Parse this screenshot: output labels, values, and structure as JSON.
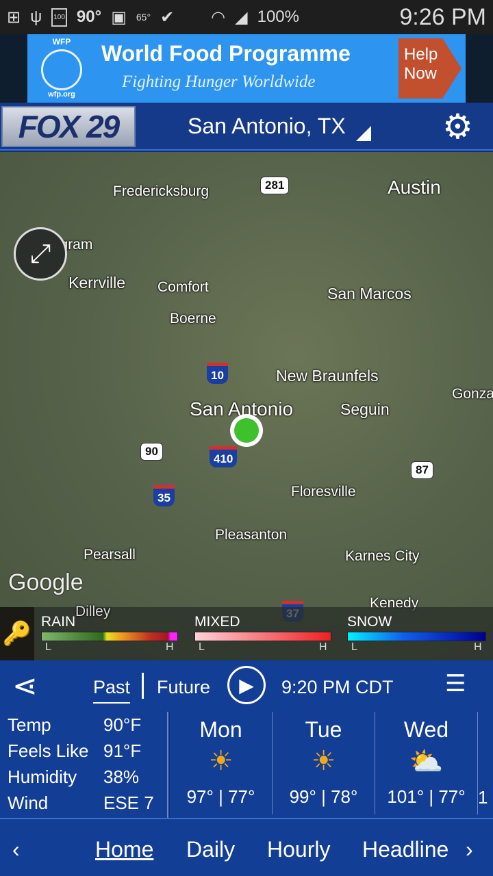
{
  "status_bar": {
    "temp": "90°",
    "weather_temp": "65°",
    "battery": "100%",
    "time": "9:26 PM",
    "battery_icon_label": "100"
  },
  "ad": {
    "org": "WFP",
    "url": "wfp.org",
    "title": "World Food Programme",
    "tagline": "Fighting Hunger Worldwide",
    "cta": "Help Now"
  },
  "header": {
    "logo": "FOX 29",
    "location": "San Antonio, TX"
  },
  "map": {
    "cities": [
      "Fredericksburg",
      "Austin",
      "Ingram",
      "Kerrville",
      "Comfort",
      "San Marcos",
      "Boerne",
      "New Braunfels",
      "San Antonio",
      "Seguin",
      "Gonza",
      "Floresville",
      "Pleasanton",
      "Pearsall",
      "Karnes City",
      "Kenedy",
      "Dilley"
    ],
    "highways": [
      "281",
      "10",
      "90",
      "410",
      "35",
      "87",
      "37"
    ],
    "attribution": "Google",
    "location_color": "#3ec12c"
  },
  "legend": {
    "rain": "RAIN",
    "mixed": "MIXED",
    "snow": "SNOW",
    "low": "L",
    "high": "H"
  },
  "controls": {
    "past": "Past",
    "future": "Future",
    "time": "9:20 PM CDT"
  },
  "conditions": [
    {
      "label": "Temp",
      "value": "90°F"
    },
    {
      "label": "Feels Like",
      "value": "91°F"
    },
    {
      "label": "Humidity",
      "value": "38%"
    },
    {
      "label": "Wind",
      "value": "ESE 7"
    }
  ],
  "forecast": [
    {
      "day": "Mon",
      "icon": "sunny",
      "high": "97°",
      "low": "77°"
    },
    {
      "day": "Tue",
      "icon": "sunny",
      "high": "99°",
      "low": "78°"
    },
    {
      "day": "Wed",
      "icon": "partly-cloudy",
      "high": "101°",
      "low": "77°"
    },
    {
      "day": "",
      "high": "1"
    }
  ],
  "nav": {
    "items": [
      "Home",
      "Daily",
      "Hourly",
      "Headline"
    ],
    "active": "Home"
  }
}
